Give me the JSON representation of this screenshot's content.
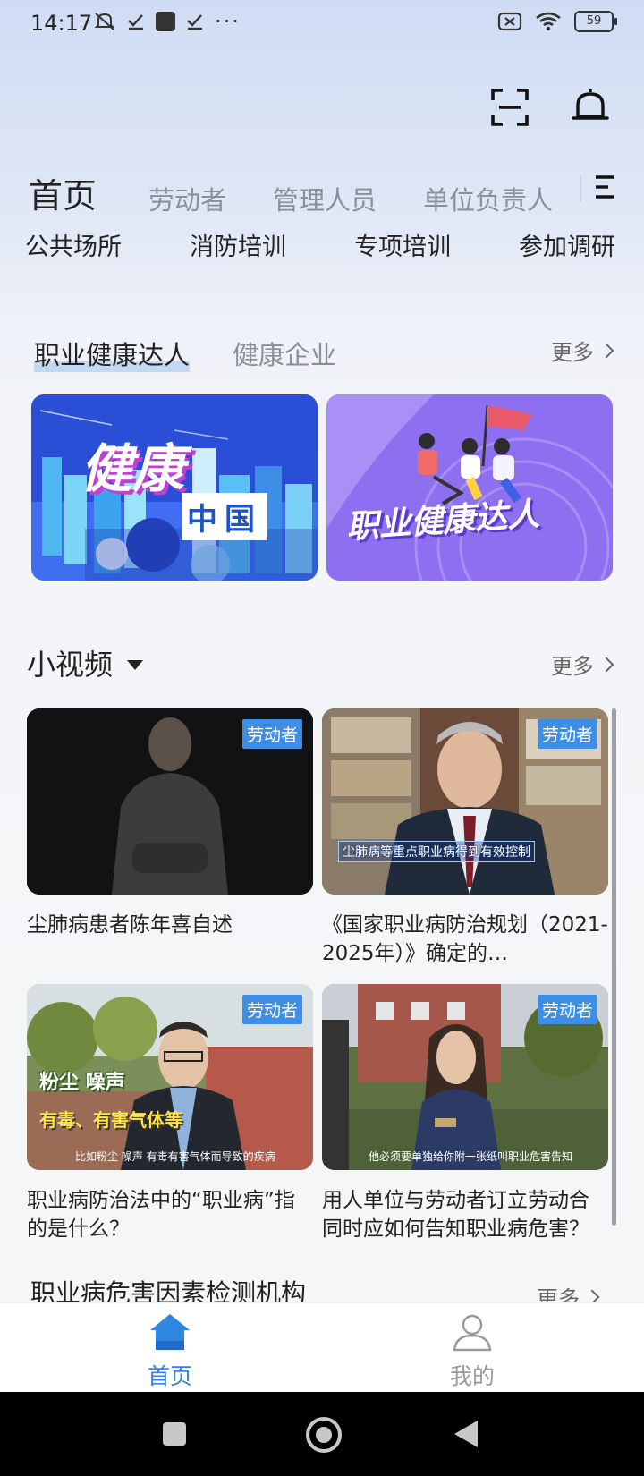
{
  "status_bar": {
    "time": "14:17",
    "battery": "59"
  },
  "header": {
    "scan_icon": "scan-icon",
    "bell_icon": "bell-icon"
  },
  "tabs_primary": [
    {
      "label": "首页",
      "active": true
    },
    {
      "label": "劳动者"
    },
    {
      "label": "管理人员"
    },
    {
      "label": "单位负责人"
    }
  ],
  "tabs_secondary": [
    "公共场所",
    "消防培训",
    "专项培训",
    "参加调研"
  ],
  "section1": {
    "tabs": [
      "职业健康达人",
      "健康企业"
    ],
    "more": "更多",
    "banners": [
      {
        "text_main": "健康",
        "text_sub": "中国"
      },
      {
        "text": "职业健康达人"
      }
    ]
  },
  "videos": {
    "title": "小视频",
    "more": "更多",
    "items": [
      {
        "badge": "劳动者",
        "caption": "尘肺病患者陈年喜自述",
        "overlay": ""
      },
      {
        "badge": "劳动者",
        "caption": "《国家职业病防治规划（2021-2025年）》确定的…",
        "overlay": "尘肺病等重点职业病得到有效控制"
      },
      {
        "badge": "劳动者",
        "caption": "职业病防治法中的“职业病”指的是什么？",
        "overlay_top": "粉尘 噪声",
        "overlay_mid": "有毒、有害气体等",
        "overlay": "比如粉尘 噪声 有毒有害气体而导致的疾病"
      },
      {
        "badge": "劳动者",
        "caption": "用人单位与劳动者订立劳动合同时应如何告知职业病危害？",
        "overlay": "他必须要单独给你附一张纸叫职业危害告知"
      }
    ]
  },
  "section3": {
    "title": "职业病危害因素检测机构",
    "more": "更多"
  },
  "bottom_nav": [
    {
      "label": "首页",
      "icon": "home-icon",
      "active": true,
      "color": "#2f86e0"
    },
    {
      "label": "我的",
      "icon": "user-icon",
      "color": "#999999"
    }
  ]
}
